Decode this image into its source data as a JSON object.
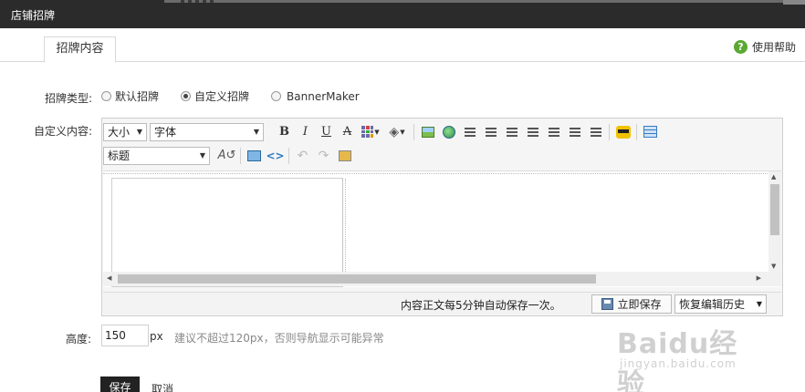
{
  "window": {
    "title": "店铺招牌"
  },
  "tabs": [
    {
      "label": "招牌内容"
    }
  ],
  "help": {
    "label": "使用帮助",
    "icon": "help-icon"
  },
  "signboard_type": {
    "label": "招牌类型:",
    "options": [
      {
        "label": "默认招牌",
        "selected": false
      },
      {
        "label": "自定义招牌",
        "selected": true
      },
      {
        "label": "BannerMaker",
        "selected": false
      }
    ]
  },
  "custom_content": {
    "label": "自定义内容:",
    "toolbar": {
      "size_label": "大小",
      "font_label": "字体",
      "heading_label": "标题",
      "buttons": {
        "bold": "B",
        "italic": "I",
        "underline": "U",
        "strike": "A"
      }
    },
    "status": {
      "autosave_text": "内容正文每5分钟自动保存一次。",
      "save_now": "立即保存",
      "restore_history": "恢复编辑历史"
    }
  },
  "height": {
    "label": "高度:",
    "value": "150",
    "unit": "px",
    "hint": "建议不超过120px，否则导航显示可能异常"
  },
  "actions": {
    "save": "保存",
    "cancel": "取消"
  },
  "watermark": {
    "brand": "Baidu经验",
    "url": "jingyan.baidu.com"
  }
}
